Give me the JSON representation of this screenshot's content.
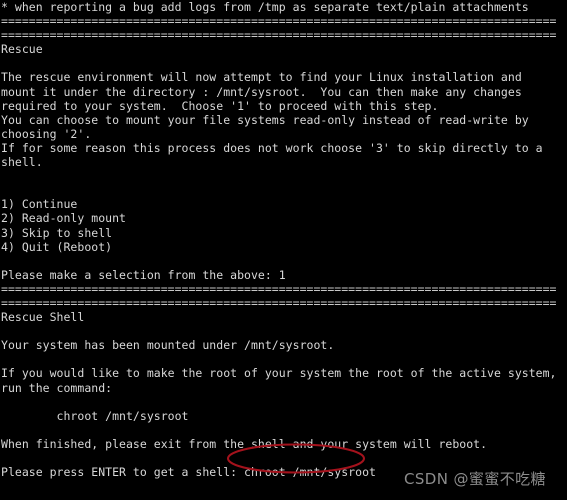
{
  "terminal": {
    "background_color": "#000000",
    "text_color": "#d8d8d8",
    "lines": [
      "* when reporting a bug add logs from /tmp as separate text/plain attachments",
      "================================================================================",
      "================================================================================",
      "Rescue",
      "",
      "The rescue environment will now attempt to find your Linux installation and",
      "mount it under the directory : /mnt/sysroot.  You can then make any changes",
      "required to your system.  Choose '1' to proceed with this step.",
      "You can choose to mount your file systems read-only instead of read-write by",
      "choosing '2'.",
      "If for some reason this process does not work choose '3' to skip directly to a",
      "shell.",
      "",
      "",
      "1) Continue",
      "2) Read-only mount",
      "3) Skip to shell",
      "4) Quit (Reboot)",
      "",
      "Please make a selection from the above: 1",
      "================================================================================",
      "================================================================================",
      "Rescue Shell",
      "",
      "Your system has been mounted under /mnt/sysroot.",
      "",
      "If you would like to make the root of your system the root of the active system,",
      "run the command:",
      "",
      "        chroot /mnt/sysroot",
      "",
      "When finished, please exit from the shell and your system will reboot.",
      "",
      "Please press ENTER to get a shell: chroot /mnt/sysroot"
    ]
  },
  "annotation": {
    "highlighted_command": "chroot /mnt/sysroot",
    "shape": "ellipse",
    "color": "#a4121c"
  },
  "watermark": {
    "text": "CSDN @蜜蜜不吃糖",
    "color": "#8c8c8c"
  }
}
